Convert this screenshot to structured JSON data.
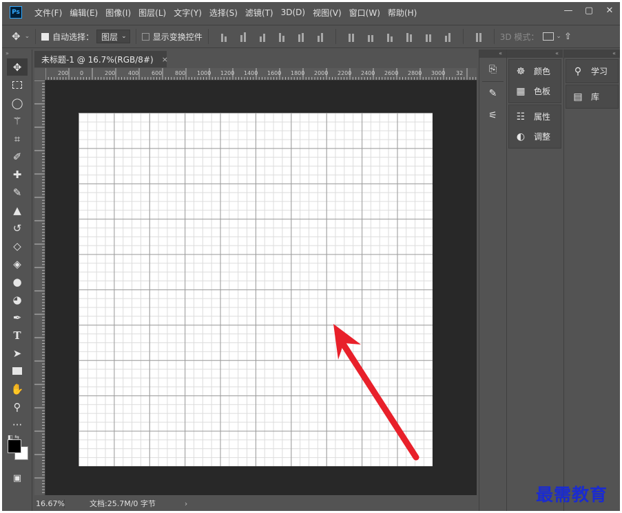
{
  "menubar": {
    "logo": "Ps",
    "items": [
      "文件(F)",
      "编辑(E)",
      "图像(I)",
      "图层(L)",
      "文字(Y)",
      "选择(S)",
      "滤镜(T)",
      "3D(D)",
      "视图(V)",
      "窗口(W)",
      "帮助(H)"
    ],
    "window_controls": {
      "minimize": "—",
      "restore": "▢",
      "close": "✕"
    }
  },
  "options": {
    "move_icon": "✥",
    "auto_select_label": "自动选择：",
    "auto_select_checked": true,
    "target_select": "图层",
    "show_transform_label": "显示变换控件",
    "show_transform_checked": false,
    "mode_3d_label": "3D 模式："
  },
  "document": {
    "tab_title": "未标题-1 @ 16.7%(RGB/8#)",
    "close_glyph": "×"
  },
  "ruler": {
    "top_ticks": [
      "200",
      "0",
      "200",
      "400",
      "600",
      "800",
      "1000",
      "1200",
      "1400",
      "1600",
      "1800",
      "2000",
      "2200",
      "2400",
      "2600",
      "2800",
      "3000",
      "32"
    ]
  },
  "status": {
    "zoom": "16.67%",
    "doc_info": "文档:25.7M/0 字节",
    "more_glyph": "›"
  },
  "tools": [
    "move-icon",
    "marquee-icon",
    "lasso-icon",
    "magic-wand-icon",
    "crop-icon",
    "eyedropper-icon",
    "healing-brush-icon",
    "brush-icon",
    "stamp-icon",
    "history-brush-icon",
    "eraser-icon",
    "paint-bucket-icon",
    "blur-icon",
    "dodge-icon",
    "pen-icon",
    "type-icon",
    "path-select-icon",
    "rectangle-icon",
    "hand-icon",
    "zoom-icon",
    "more-tools-icon"
  ],
  "panels": {
    "col1": {
      "group1": [
        {
          "icon": "palette-icon",
          "label": "颜色"
        },
        {
          "icon": "swatches-icon",
          "label": "色板"
        }
      ],
      "group2": [
        {
          "icon": "properties-icon",
          "label": "属性"
        },
        {
          "icon": "adjustments-icon",
          "label": "调整"
        }
      ]
    },
    "col2": {
      "group1": [
        {
          "icon": "lightbulb-icon",
          "label": "学习"
        }
      ],
      "group2": [
        {
          "icon": "library-icon",
          "label": "库"
        }
      ]
    }
  },
  "annotation": {
    "arrow_color": "#e8202a"
  },
  "watermark": "最需教育"
}
